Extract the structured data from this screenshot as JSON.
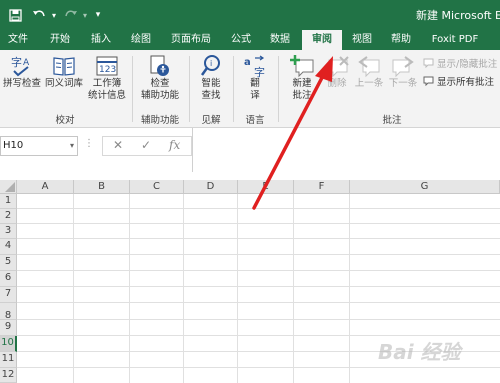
{
  "window": {
    "title": "新建 Microsoft Exc",
    "qat": [
      "save-icon",
      "undo-icon",
      "redo-icon",
      "customize-qat-icon"
    ]
  },
  "tabs": [
    "文件",
    "开始",
    "插入",
    "绘图",
    "页面布局",
    "公式",
    "数据",
    "审阅",
    "视图",
    "帮助",
    "Foxit PDF"
  ],
  "active_tab": "审阅",
  "ribbon": {
    "groups": {
      "proofing": {
        "label": "校对",
        "buttons": [
          "拼写检查",
          "同义词库",
          "工作簿",
          "统计信息"
        ]
      },
      "accessibility": {
        "label": "辅助功能",
        "button": [
          "检查",
          "辅助功能"
        ]
      },
      "insights": {
        "label": "见解",
        "button": [
          "智能",
          "查找"
        ]
      },
      "language": {
        "label": "语言",
        "button": [
          "翻",
          "译"
        ]
      },
      "comments": {
        "label": "批注",
        "new": [
          "新建",
          "批注"
        ],
        "delete": "删除",
        "previous": "上一条",
        "next": "下一条",
        "show_hide": "显示/隐藏批注",
        "show_all": "显示所有批注"
      }
    }
  },
  "formula_bar": {
    "name_box": "H10",
    "fx": "fx",
    "value": ""
  },
  "grid": {
    "columns": [
      "A",
      "B",
      "C",
      "D",
      "E",
      "F",
      "G"
    ],
    "rows": [
      "1",
      "2",
      "3",
      "4",
      "5",
      "6",
      "7",
      "8",
      "9",
      "10",
      "11",
      "12"
    ],
    "selected_row": "10"
  },
  "watermark": "Bai 经验",
  "colors": {
    "excel_green": "#217346",
    "annotation_arrow": "#e02020"
  }
}
